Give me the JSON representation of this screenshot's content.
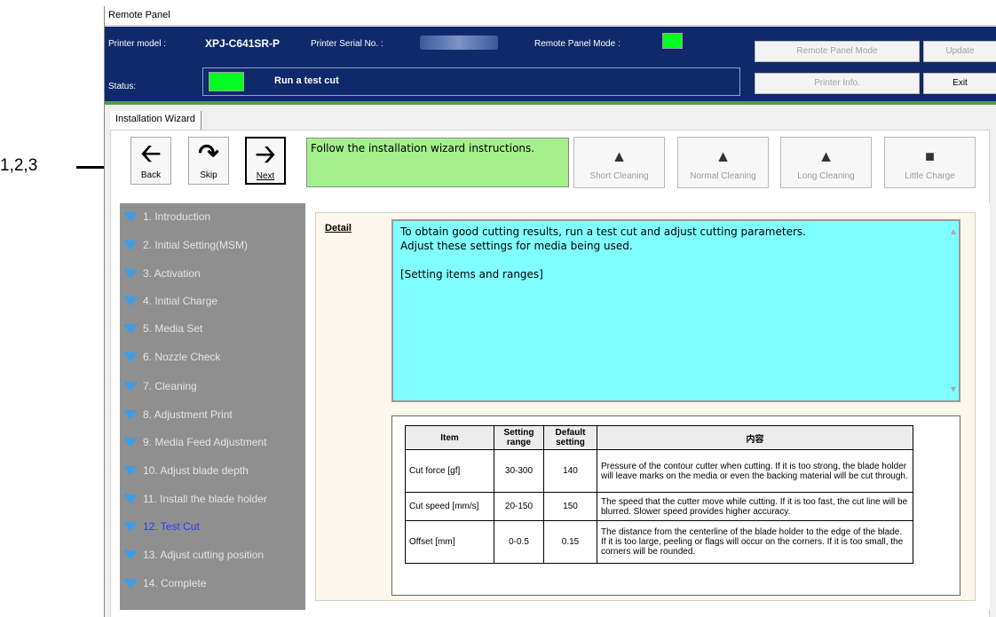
{
  "callout": "1,2,3",
  "window": {
    "title": "Remote Panel"
  },
  "header": {
    "model_label": "Printer model :",
    "model": "XPJ-C641SR-P",
    "serial_label": "Printer Serial No. :",
    "mode_label": "Remote Panel Mode :",
    "status_label": "Status:",
    "status_text": "Run a test cut",
    "buttons": {
      "remote_panel_mode": "Remote Panel Mode",
      "update": "Update",
      "printer_info": "Printer Info.",
      "exit": "Exit"
    },
    "led_color": "#00ff21"
  },
  "tab": "Installation Wizard",
  "toolbar": {
    "back": "Back",
    "skip": "Skip",
    "next": "Next",
    "instruction": "Follow the installation wizard instructions.",
    "short_cleaning": "Short Cleaning",
    "normal_cleaning": "Normal Cleaning",
    "long_cleaning": "Long Cleaning",
    "little_charge": "Little Charge"
  },
  "steps": [
    "1. Introduction",
    "2. Initial Setting(MSM)",
    "3. Activation",
    "4. Initial Charge",
    "5. Media Set",
    "6. Nozzle Check",
    "7. Cleaning",
    "8. Adjustment Print",
    "9. Media Feed Adjustment",
    "10. Adjust blade depth",
    "11. Install the blade holder",
    "12. Test Cut",
    "13. Adjust cutting position",
    "14. Complete"
  ],
  "active_step": "12. Test Cut",
  "detail": {
    "label": "Detail",
    "line1": "To obtain good cutting results, run a test cut and adjust cutting parameters.",
    "line2": "Adjust these settings for media being used.",
    "line3": "[Setting items and ranges]"
  },
  "table": {
    "headers": [
      "Item",
      "Setting range",
      "Default setting",
      "内容"
    ],
    "rows": [
      [
        "Cut force [gf]",
        "30-300",
        "140",
        "Pressure of the contour cutter when cutting. If it is too strong, the blade holder will leave marks on the media or even the backing material will be cut through."
      ],
      [
        "Cut speed [mm/s]",
        "20-150",
        "150",
        "The speed that the cutter move while cutting. If it is too fast, the cut line will be blurred. Slower speed provides higher accuracy."
      ],
      [
        "Offset [mm]",
        "0-0.5",
        "0.15",
        "The distance from the centerline of the blade holder to the edge of the blade. If it is too large, peeling or flags will occur on the corners. If it is too small, the corners will be rounded."
      ]
    ]
  }
}
